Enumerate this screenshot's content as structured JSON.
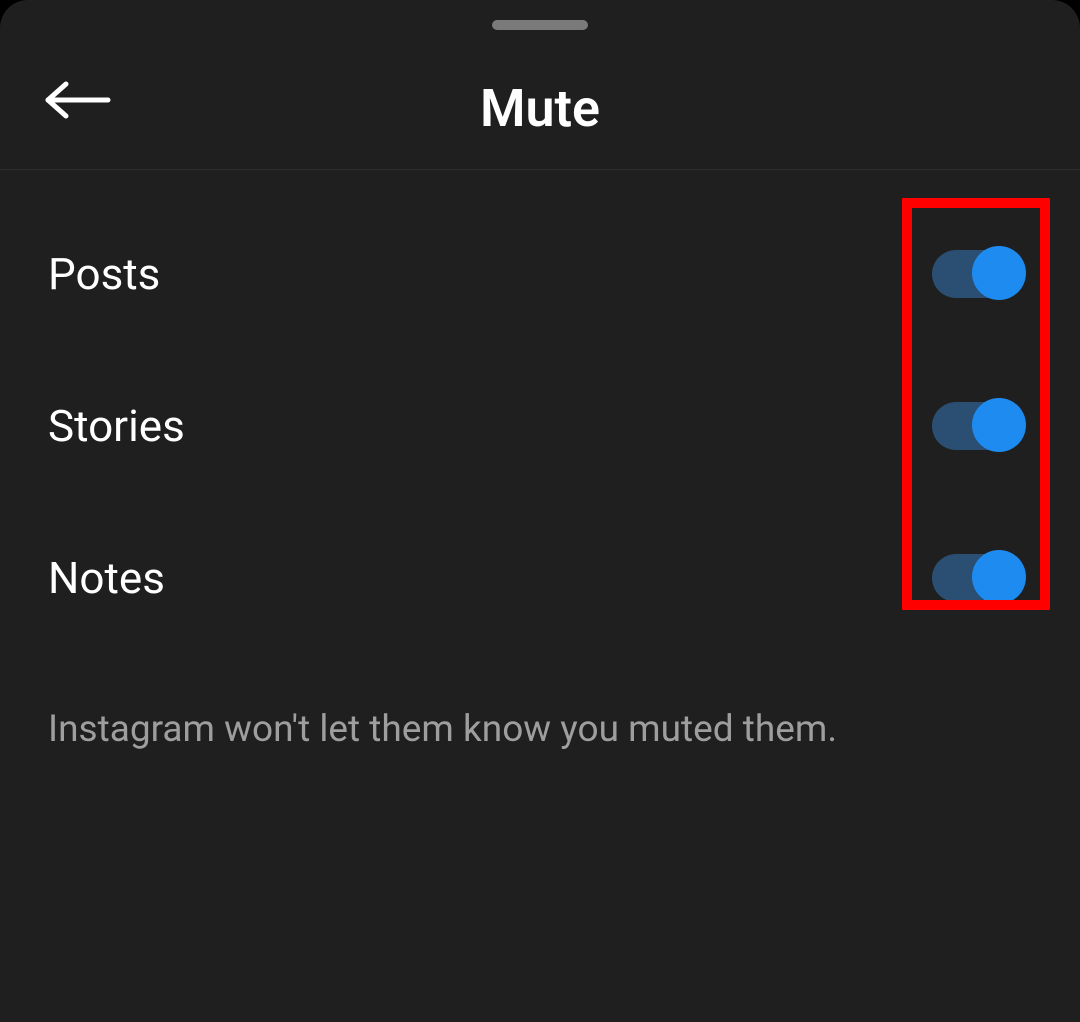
{
  "header": {
    "title": "Mute"
  },
  "rows": [
    {
      "label": "Posts",
      "enabled": true
    },
    {
      "label": "Stories",
      "enabled": true
    },
    {
      "label": "Notes",
      "enabled": true
    }
  ],
  "info": "Instagram won't let them know you muted them.",
  "highlight": {
    "color": "#ff0000"
  }
}
